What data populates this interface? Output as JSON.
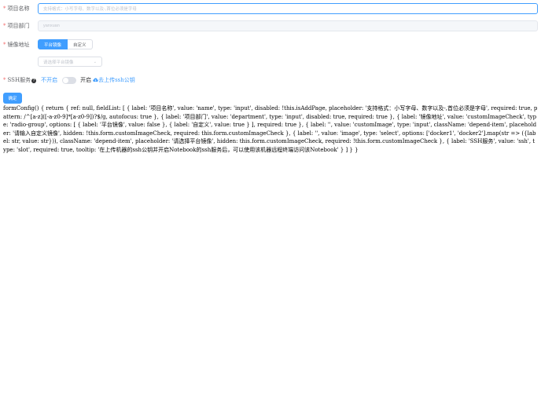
{
  "form": {
    "name": {
      "label": "项目名称",
      "placeholder": "支持格式：小写字母、数字以及-,首位必须是字母"
    },
    "department": {
      "label": "项目部门",
      "value": "yanxuan"
    },
    "image": {
      "label": "镜像地址",
      "options": [
        "平台镜像",
        "自定义"
      ],
      "selected": "平台镜像",
      "select_placeholder": "请选择平台镜像"
    },
    "ssh": {
      "label": "SSH服务",
      "off_label": "不开启",
      "on_label": "开启",
      "upload_label": "去上传ssh公钥",
      "enabled": false
    },
    "submit_label": "确定"
  },
  "code_text": "formConfig() { return { ref: null, fieldList: [ { label: '项目名称', value: 'name', type: 'input', disabled: !this.isAddPage, placeholder: '支持格式：小写字母、数字以及-,首位必须是字母', required: true, pattern: /^[a-z]([-a-z0-9]*[a-z0-9])?$/g, autofocus: true }, { label: '项目部门', value: 'department', type: 'input', disabled: true, required: true }, { label: '镜像地址', value: 'customImageCheck', type: 'radio-group', options: [ { label: '平台镜像', value: false }, { label: '自定义', value: true } ], required: true }, { label: '', value: 'customImage', type: 'input', className: 'depend-item', placeholder: '请输入自定义镜像', hidden: !this.form.customImageCheck, required: this.form.customImageCheck }, { label: '', value: 'image', type: 'select', options: ['docker1', 'docker2'].map(str => ({label: str, value: str})), className: 'depend-item', placeholder: '请选择平台镜像', hidden: this.form.customImageCheck, required: !this.form.customImageCheck }, { label: 'SSH服务', value: 'ssh', type: 'slot', required: true, tooltip: '在上传机器的ssh公钥并开启Notebook的ssh服务后，可以使用该机器远程终端访问该Notebook' } ] } }"
}
